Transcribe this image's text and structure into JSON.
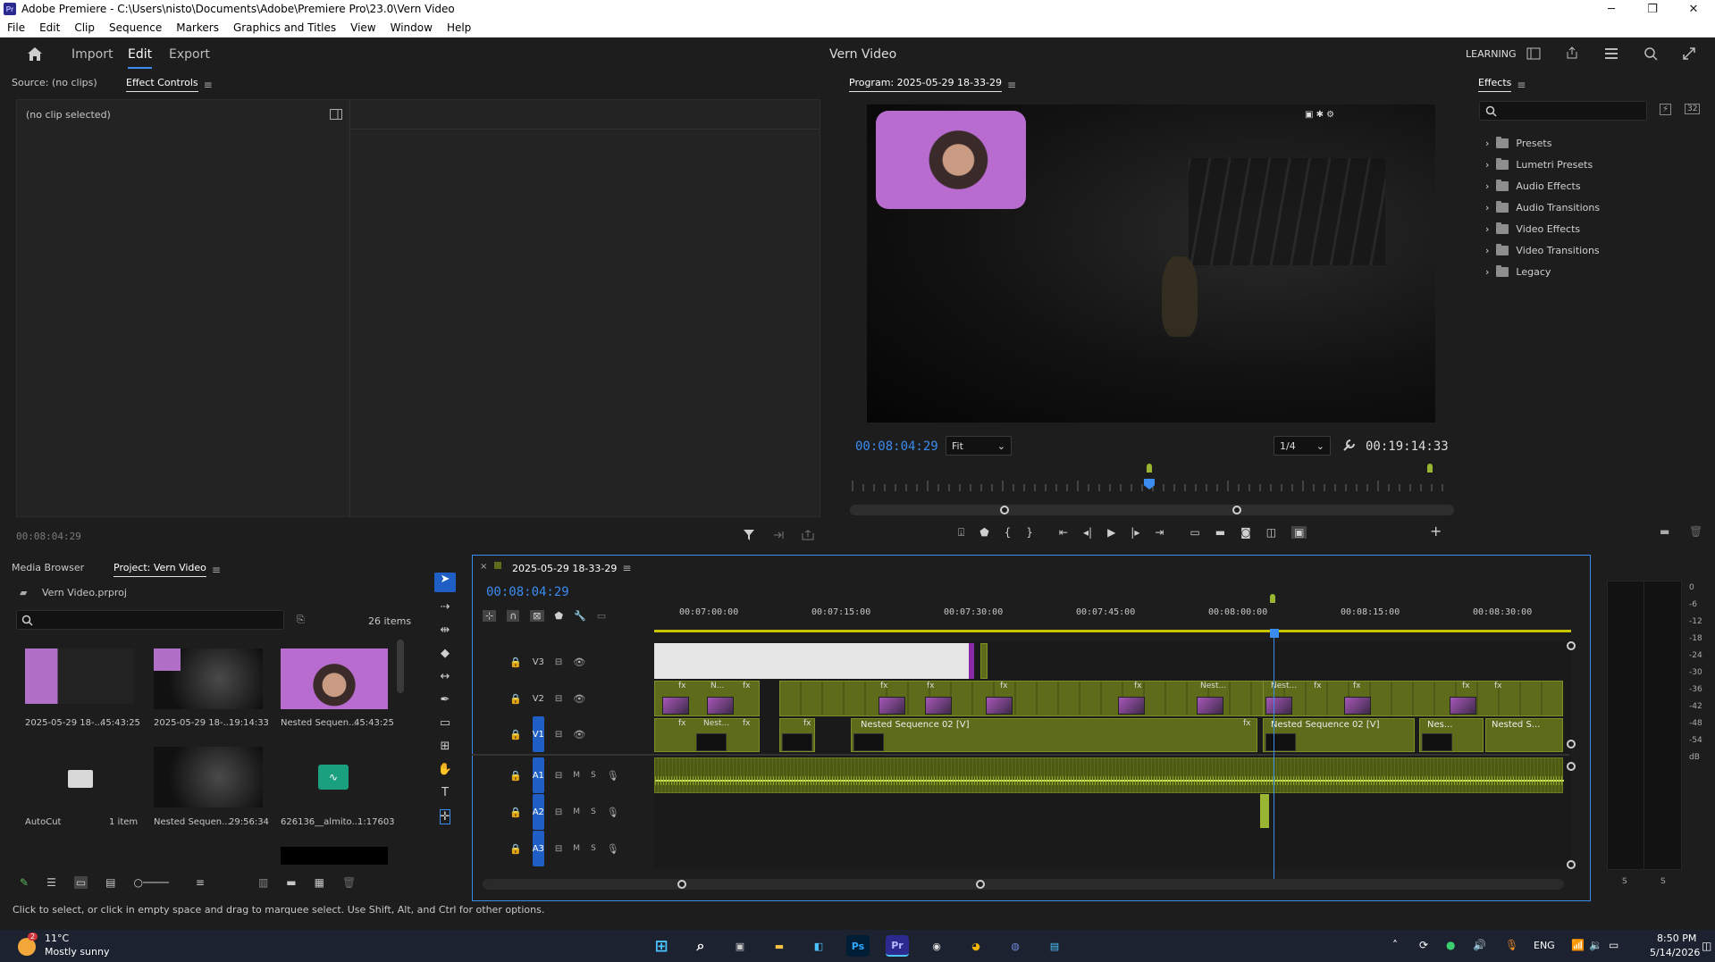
{
  "window": {
    "app_icon_text": "Pr",
    "title": "Adobe Premiere - C:\\Users\\nisto\\Documents\\Adobe\\Premiere Pro\\23.0\\Vern Video",
    "minimize": "─",
    "maximize": "❐",
    "close": "✕"
  },
  "menu": [
    "File",
    "Edit",
    "Clip",
    "Sequence",
    "Markers",
    "Graphics and Titles",
    "View",
    "Window",
    "Help"
  ],
  "workspace": {
    "tabs": [
      "Import",
      "Edit",
      "Export"
    ],
    "active_tab": "Edit",
    "project_title": "Vern Video",
    "learning_label": "LEARNING"
  },
  "source_panel": {
    "tab_source": "Source: (no clips)",
    "tab_effect_controls": "Effect Controls",
    "no_clip": "(no clip selected)",
    "timecode": "00:08:04:29"
  },
  "program_monitor": {
    "title": "Program: 2025-05-29 18-33-29",
    "current_time": "00:08:04:29",
    "zoom": "Fit",
    "resolution": "1/4",
    "duration": "00:19:14:33"
  },
  "effects_panel": {
    "title": "Effects",
    "items": [
      "Presets",
      "Lumetri Presets",
      "Audio Effects",
      "Audio Transitions",
      "Video Effects",
      "Video Transitions",
      "Legacy"
    ]
  },
  "project_panel": {
    "tab_media_browser": "Media Browser",
    "tab_project": "Project: Vern Video",
    "project_file": "Vern Video.prproj",
    "item_count": "26 items",
    "items": [
      {
        "name": "2025-05-29 18-...",
        "duration": "45:43:25"
      },
      {
        "name": "2025-05-29 18-...",
        "duration": "19:14:33"
      },
      {
        "name": "Nested Sequen...",
        "duration": "45:43:25"
      },
      {
        "name": "AutoCut",
        "duration": "1 item"
      },
      {
        "name": "Nested Sequen...",
        "duration": "29:56:34"
      },
      {
        "name": "626136__almito...",
        "duration": "1:17603"
      }
    ]
  },
  "timeline": {
    "sequence_name": "2025-05-29 18-33-29",
    "playhead_time": "00:08:04:29",
    "ruler_labels": [
      "00:07:00:00",
      "00:07:15:00",
      "00:07:30:00",
      "00:07:45:00",
      "00:08:00:00",
      "00:08:15:00",
      "00:08:30:00"
    ],
    "tracks": [
      {
        "id": "V3",
        "kind": "video"
      },
      {
        "id": "V2",
        "kind": "video"
      },
      {
        "id": "V1",
        "kind": "video"
      },
      {
        "id": "A1",
        "kind": "audio"
      },
      {
        "id": "A2",
        "kind": "audio"
      },
      {
        "id": "A3",
        "kind": "audio"
      }
    ],
    "track_ms_m": "M",
    "track_ms_s": "S",
    "clip_labels": {
      "fx": "fx",
      "n": "N...",
      "nest": "Nest...",
      "nested_long": "Nested Sequence 02 [V]",
      "nes": "Nes...",
      "nested_s": "Nested S..."
    }
  },
  "audio_meter": {
    "scale": [
      "0",
      "-6",
      "-12",
      "-18",
      "-24",
      "-30",
      "-36",
      "-42",
      "-48",
      "-54",
      "dB"
    ],
    "channels": [
      "S",
      "S"
    ]
  },
  "status_bar": {
    "text": "Click to select, or click in empty space and drag to marquee select. Use Shift, Alt, and Ctrl for other options."
  },
  "taskbar": {
    "weather_temp": "11°C",
    "weather_desc": "Mostly sunny",
    "weather_badge": "2",
    "lang": "ENG",
    "time": "8:50 PM",
    "date": "5/14/2026"
  },
  "colors": {
    "accent_blue": "#3a8cf0",
    "clip_green": "#5d6b1a",
    "audio_green": "#9ab531",
    "panel_bg": "#232323"
  }
}
